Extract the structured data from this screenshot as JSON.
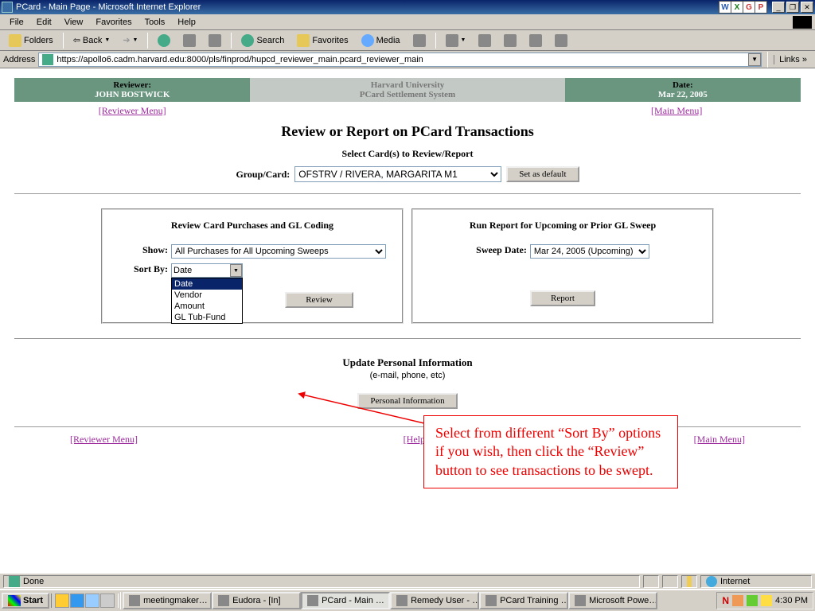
{
  "titlebar": {
    "text": "PCard - Main Page - Microsoft Internet Explorer",
    "app_icons": [
      "W",
      "X",
      "G",
      "P"
    ]
  },
  "menubar": {
    "items": [
      "File",
      "Edit",
      "View",
      "Favorites",
      "Tools",
      "Help"
    ]
  },
  "toolbar": {
    "folders": "Folders",
    "back": "Back",
    "search": "Search",
    "favorites": "Favorites",
    "media": "Media"
  },
  "addressbar": {
    "label": "Address",
    "url": "https://apollo6.cadm.harvard.edu:8000/pls/finprod/hupcd_reviewer_main.pcard_reviewer_main",
    "links": "Links"
  },
  "header": {
    "reviewer_label": "Reviewer:",
    "reviewer_name": "JOHN BOSTWICK",
    "org_line1": "Harvard University",
    "org_line2": "PCard Settlement System",
    "date_label": "Date:",
    "date_value": "Mar 22, 2005"
  },
  "links": {
    "reviewer_menu": "[Reviewer Menu]",
    "main_menu": "[Main Menu]",
    "help": "[Help]"
  },
  "page": {
    "title": "Review or Report on PCard Transactions",
    "select_cards": "Select Card(s) to Review/Report",
    "group_card_label": "Group/Card:",
    "group_card_value": "OFSTRV / RIVERA, MARGARITA M1",
    "set_default": "Set as default"
  },
  "left_panel": {
    "title": "Review Card Purchases and GL Coding",
    "show_label": "Show:",
    "show_value": "All Purchases for All Upcoming Sweeps",
    "sort_label": "Sort By:",
    "sort_value": "Date",
    "sort_options": [
      "Date",
      "Vendor",
      "Amount",
      "GL Tub-Fund"
    ],
    "review_btn": "Review"
  },
  "right_panel": {
    "title": "Run Report for Upcoming or Prior GL Sweep",
    "sweep_label": "Sweep Date:",
    "sweep_value": "Mar 24, 2005 (Upcoming)",
    "report_btn": "Report"
  },
  "update": {
    "title": "Update Personal Information",
    "sub": "(e-mail, phone, etc)",
    "btn": "Personal Information"
  },
  "callout": "Select from different “Sort By” options if you wish, then click the “Review” button to see transactions to be swept.",
  "statusbar": {
    "done": "Done",
    "zone": "Internet"
  },
  "taskbar": {
    "start": "Start",
    "items": [
      "meetingmaker…",
      "Eudora - [In]",
      "PCard - Main …",
      "Remedy User - …",
      "PCard Training …",
      "Microsoft Powe…"
    ],
    "active_index": 2,
    "time": "4:30 PM",
    "tray_text": "N"
  }
}
